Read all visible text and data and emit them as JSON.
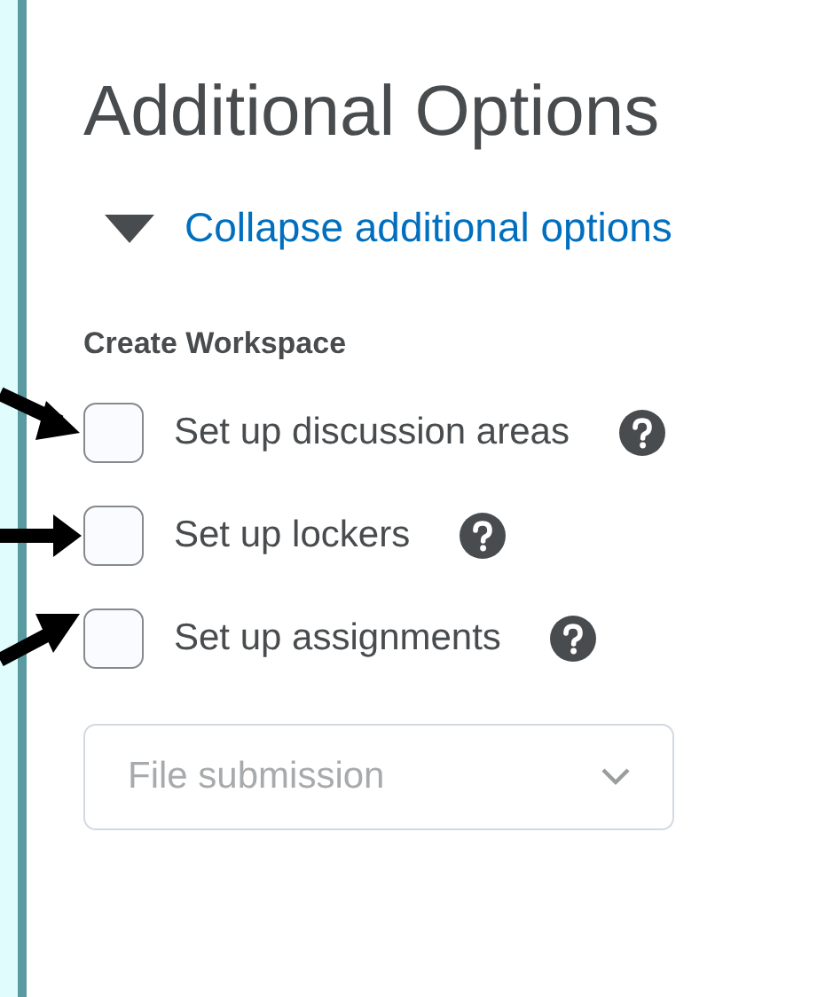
{
  "heading": "Additional Options",
  "toggle": {
    "label": "Collapse additional options",
    "expanded": true
  },
  "section": {
    "title": "Create Workspace",
    "options": [
      {
        "label": "Set up discussion areas",
        "checked": false,
        "help": true
      },
      {
        "label": "Set up lockers",
        "checked": false,
        "help": true
      },
      {
        "label": "Set up assignments",
        "checked": false,
        "help": true
      }
    ],
    "dropdown": {
      "placeholder": "File submission",
      "disabled": true
    }
  }
}
